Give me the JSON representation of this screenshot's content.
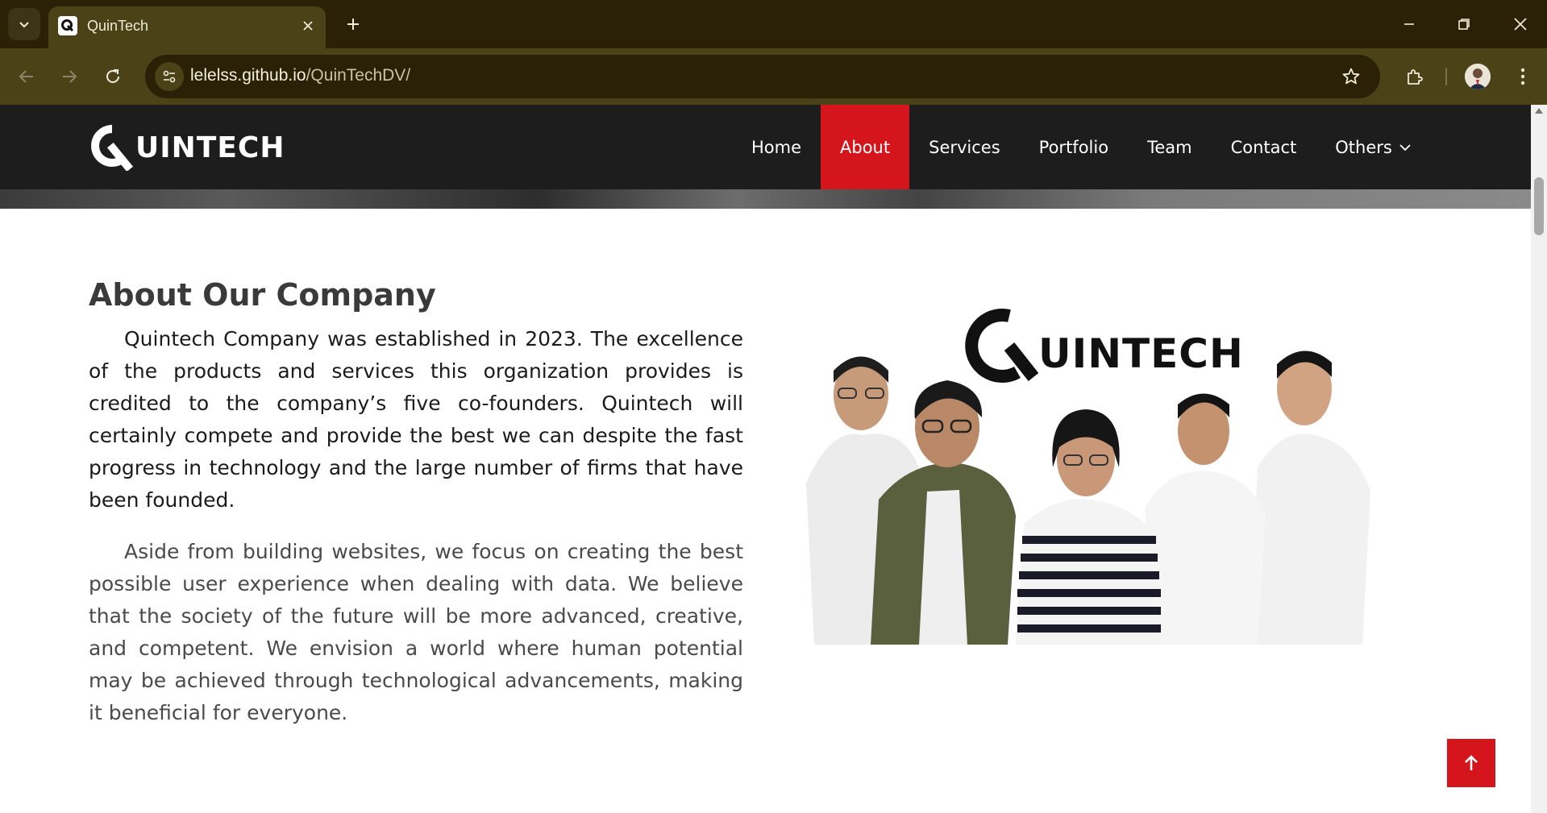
{
  "browser": {
    "tab_title": "QuinTech",
    "url_host": "lelelss.github.io",
    "url_path": "/QuinTechDV/"
  },
  "site": {
    "logo_text": "UINTECH",
    "logo_letter": "Q",
    "nav": [
      {
        "label": "Home",
        "active": false
      },
      {
        "label": "About",
        "active": true
      },
      {
        "label": "Services",
        "active": false
      },
      {
        "label": "Portfolio",
        "active": false
      },
      {
        "label": "Team",
        "active": false
      },
      {
        "label": "Contact",
        "active": false
      },
      {
        "label": "Others",
        "active": false,
        "dropdown": true
      }
    ]
  },
  "about": {
    "title": "About Our Company",
    "paragraph1": "Quintech Company was established in 2023. The excellence of the products and services this organization provides is credited to the company’s five co-founders. Quintech will certainly compete and provide the best we can despite the fast progress in technology and the large number of firms that have been founded.",
    "paragraph2": "Aside from building websites, we focus on creating the best possible user experience when dealing with data. We believe that the society of the future will be more advanced, creative, and competent. We envision a world where human potential may be achieved through technological advancements, making it beneficial for everyone.",
    "photo_logo_text": "UINTECH"
  },
  "colors": {
    "accent": "#d4161c",
    "header_bg": "#1d1d1d",
    "browser_frame": "#4b4217"
  },
  "icons": {
    "back_to_top": "arrow-up-icon"
  }
}
